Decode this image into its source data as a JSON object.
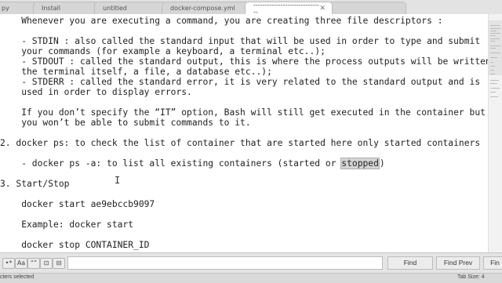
{
  "tabs": [
    {
      "label": "py",
      "active": false
    },
    {
      "label": "Install",
      "active": false
    },
    {
      "label": "untitled",
      "active": false
    },
    {
      "label": "docker-compose.yml",
      "active": false
    },
    {
      "label": "-------------------------------",
      "active": true
    },
    {
      "label": "",
      "active": false
    }
  ],
  "editor": {
    "lines": [
      "    Whenever you are executing a command, you are creating three file descriptors :",
      "",
      "    - STDIN : also called the standard input that will be used in order to type and submit",
      "    your commands (for example a keyboard, a terminal etc..);",
      "    - STDOUT : called the standard output, this is where the process outputs will be written (",
      "    the terminal itself, a file, a database etc..);",
      "    - STDERR : called the standard error, it is very related to the standard output and is",
      "    used in order to display errors.",
      "",
      "    If you don’t specify the “IT” option, Bash will still get executed in the container but",
      "    you won’t be able to submit commands to it.",
      "",
      "2. docker ps: to check the list of container that are started here only started containers",
      "",
      "    - docker ps -a: to list all existing containers (started or ",
      "",
      "3. Start/Stop",
      "",
      "    docker start ae9ebccb9097",
      "",
      "    Example: docker start",
      "",
      "    docker stop CONTAINER_ID"
    ],
    "selected_word": "stopped",
    "after_selection": ")"
  },
  "findbar": {
    "options": [
      "•*",
      "Aa",
      "“”",
      "⊡",
      "⊟"
    ],
    "search_value": "",
    "find_label": "Find",
    "find_prev_label": "Find Prev",
    "find_all_label": "Fin"
  },
  "status": {
    "left": "cters selected",
    "right": "Tab Size: 4"
  }
}
